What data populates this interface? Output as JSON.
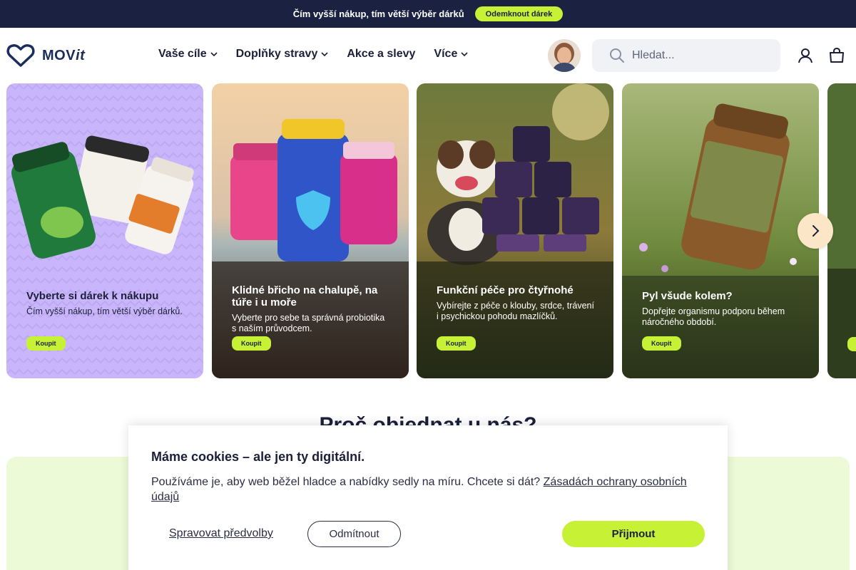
{
  "promo": {
    "text": "Čím vyšší nákup, tím větší výběr dárků",
    "button": "Odemknout dárek"
  },
  "logo": {
    "text_main": "MOV",
    "text_italic": "it"
  },
  "nav": [
    {
      "label": "Vaše cíle",
      "dropdown": true
    },
    {
      "label": "Doplňky stravy",
      "dropdown": true
    },
    {
      "label": "Akce a slevy",
      "dropdown": false
    },
    {
      "label": "Více",
      "dropdown": true
    }
  ],
  "search": {
    "placeholder": "Hledat..."
  },
  "cards": [
    {
      "title": "Vyberte si dárek k nákupu",
      "desc": "Čím vyšší nákup, tím větší výběr dárků.",
      "button": "Koupit"
    },
    {
      "title": "Klidné břicho na chalupě, na túře i u moře",
      "desc": "Vyberte pro sebe ta správná probiotika s naším průvodcem.",
      "button": "Koupit"
    },
    {
      "title": "Funkční péče pro čtyřnohé",
      "desc": "Vybírejte z péče o klouby, srdce, trávení i psychickou pohodu mazlíčků.",
      "button": "Koupit"
    },
    {
      "title": "Pyl všude kolem?",
      "desc": "Dopřejte organismu podporu během náročného období.",
      "button": "Koupit"
    }
  ],
  "section": {
    "title": "Proč objednat u nás?"
  },
  "cookie": {
    "title": "Máme cookies – ale jen ty digitální.",
    "text": "Používáme je, aby web běžel hladce a nabídky sedly na míru. Chcete si dát?",
    "link": "Zásadách ochrany osobních údajů",
    "manage": "Spravovat předvolby",
    "reject": "Odmítnout",
    "accept": "Přijmout"
  },
  "colors": {
    "navy": "#1b2141",
    "lime": "#c6f135",
    "lavender": "#c9b6fa",
    "mint": "#ecfad8"
  },
  "icons": [
    "heart-logo-icon",
    "chevron-down-icon",
    "search-icon",
    "user-icon",
    "cart-icon",
    "chevron-right-icon"
  ]
}
